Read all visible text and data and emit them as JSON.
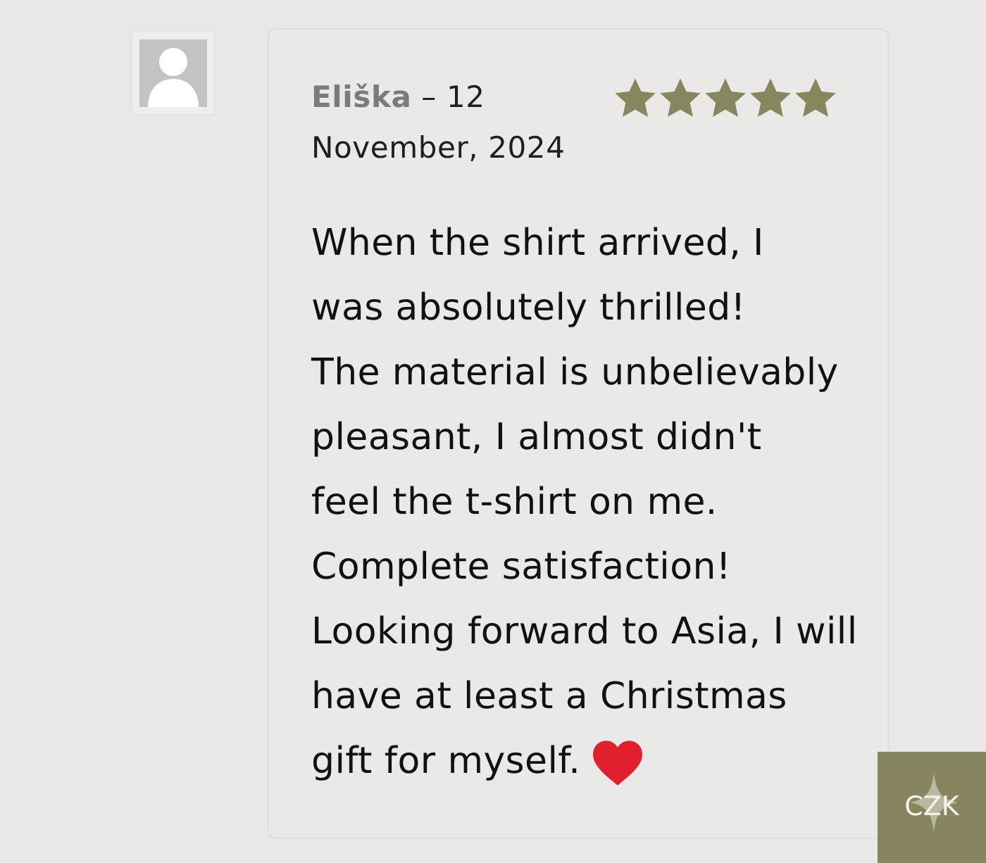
{
  "review": {
    "byline": "**Eliška** – 12 November, 2024",
    "stars": 5,
    "lines": [
      "When the shirt arrived, I",
      "was absolutely thrilled!",
      "The material is unbelievably",
      "pleasant, I almost didn't",
      "feel the t-shirt on me.",
      "Complete satisfaction!",
      "Looking forward to Asia, I will",
      "have at least a Christmas",
      "gift for myself."
    ]
  },
  "currency_button": {
    "label": "CZK"
  }
}
